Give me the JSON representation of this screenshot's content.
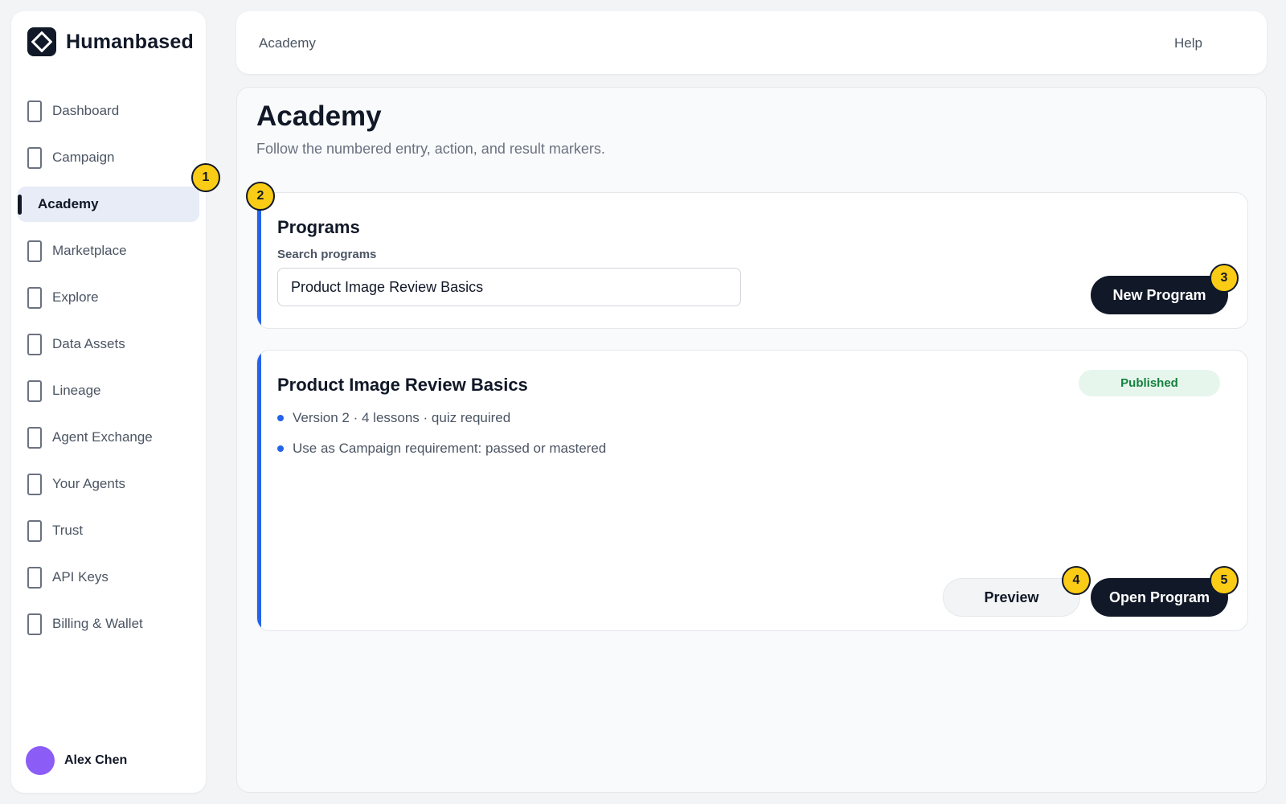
{
  "brand": {
    "name": "Humanbased",
    "logo_icon": "diamond-logo-icon"
  },
  "sidebar": {
    "items": [
      {
        "label": "Dashboard",
        "icon": "page-icon",
        "active": false
      },
      {
        "label": "Campaign",
        "icon": "page-icon",
        "active": false
      },
      {
        "label": "Academy",
        "icon": "",
        "active": true
      },
      {
        "label": "Marketplace",
        "icon": "page-icon",
        "active": false
      },
      {
        "label": "Explore",
        "icon": "page-icon",
        "active": false
      },
      {
        "label": "Data Assets",
        "icon": "page-icon",
        "active": false
      },
      {
        "label": "Lineage",
        "icon": "page-icon",
        "active": false
      },
      {
        "label": "Agent Exchange",
        "icon": "page-icon",
        "active": false
      },
      {
        "label": "Your Agents",
        "icon": "page-icon",
        "active": false
      },
      {
        "label": "Trust",
        "icon": "page-icon",
        "active": false
      },
      {
        "label": "API Keys",
        "icon": "page-icon",
        "active": false
      },
      {
        "label": "Billing & Wallet",
        "icon": "page-icon",
        "active": false
      }
    ],
    "user": {
      "name": "Alex Chen",
      "avatar_color": "#8b5cf6"
    }
  },
  "topbar": {
    "title": "Academy",
    "help": "Help"
  },
  "page": {
    "title": "Academy",
    "subtitle": "Follow the numbered entry, action, and result markers."
  },
  "programs": {
    "title": "Programs",
    "search_label": "Search programs",
    "search_value": "Product Image Review Basics",
    "new_button": "New Program"
  },
  "program_detail": {
    "title": "Product Image Review Basics",
    "status": "Published",
    "bullets": [
      "Version 2 · 4 lessons · quiz required",
      "Use as Campaign requirement: passed or mastered"
    ],
    "preview_button": "Preview",
    "open_button": "Open Program"
  },
  "markers": [
    "1",
    "2",
    "3",
    "4",
    "5"
  ],
  "colors": {
    "accent": "#2563eb",
    "dark": "#111827",
    "marker": "#facc15",
    "published_bg": "#e6f6ed",
    "published_text": "#15803d"
  }
}
